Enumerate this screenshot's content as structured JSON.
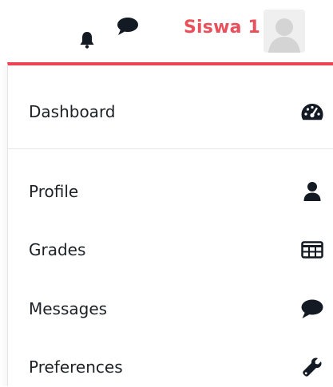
{
  "header": {
    "username": "Siswa 1"
  },
  "icons": {
    "notifications": "bell-icon",
    "messages": "chat-bubble-icon",
    "avatar": "user-avatar"
  },
  "menu": {
    "items": [
      {
        "label": "Dashboard",
        "icon": "dashboard-gauge-icon"
      },
      {
        "label": "Profile",
        "icon": "user-icon"
      },
      {
        "label": "Grades",
        "icon": "table-icon"
      },
      {
        "label": "Messages",
        "icon": "chat-bubble-icon"
      },
      {
        "label": "Preferences",
        "icon": "wrench-icon"
      }
    ]
  },
  "colors": {
    "accent": "#ef4351",
    "username": "#e8505b",
    "icon": "#141a24",
    "text": "#1d2125"
  }
}
